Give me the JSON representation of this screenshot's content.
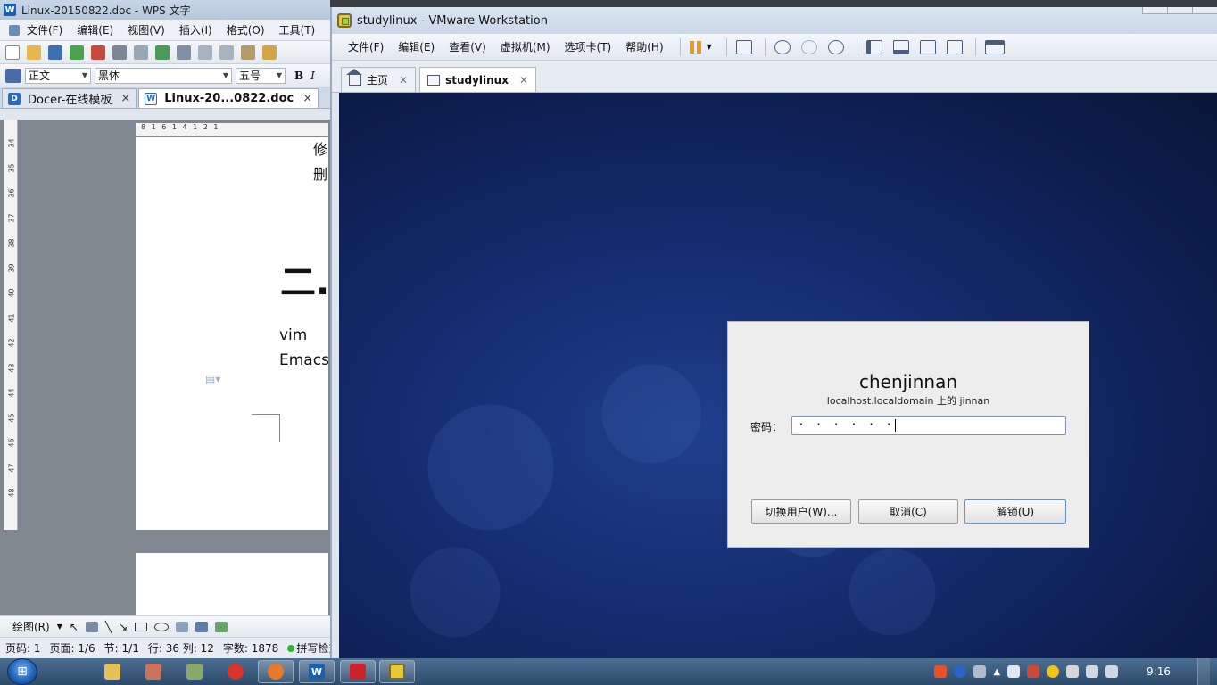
{
  "wps": {
    "title": "Linux-20150822.doc - WPS 文字",
    "menu": [
      "文件(F)",
      "编辑(E)",
      "视图(V)",
      "插入(I)",
      "格式(O)",
      "工具(T)"
    ],
    "style_value": "正文",
    "font_value": "黑体",
    "size_value": "五号",
    "tabs": [
      {
        "label": "Docer-在线模板",
        "active": false
      },
      {
        "label": "Linux-20...0822.doc",
        "active": true
      }
    ],
    "ruler_h": "8 1 6 1 4 1 2 1",
    "ruler_v": [
      "34",
      "35",
      "36",
      "37",
      "38",
      "39",
      "40",
      "41",
      "42",
      "43",
      "44",
      "45",
      "46",
      "47",
      "48"
    ],
    "page_text": {
      "line1": "修",
      "line2": "删",
      "heading": "二.",
      "vim": "vim",
      "emacs": "Emacs"
    },
    "drawbar_label": "绘图(R)",
    "status": {
      "page": "页码: 1",
      "pages": "页面: 1/6",
      "section": "节: 1/1",
      "rowcol": "行: 36  列: 12",
      "words": "字数: 1878",
      "spell": "拼写检查"
    }
  },
  "vmware": {
    "title": "studylinux - VMware Workstation",
    "menu": [
      "文件(F)",
      "编辑(E)",
      "查看(V)",
      "虚拟机(M)",
      "选项卡(T)",
      "帮助(H)"
    ],
    "tabs": [
      {
        "label": "主页",
        "active": false
      },
      {
        "label": "studylinux",
        "active": true
      }
    ],
    "dialog": {
      "username": "chenjinnan",
      "host": "localhost.localdomain 上的  jinnan",
      "password_label": "密码：",
      "password_mask": "· · · · · ·",
      "switch_user": "切换用户(W)...",
      "cancel": "取消(C)",
      "unlock": "解锁(U)"
    }
  },
  "taskbar": {
    "clock": "9:16"
  },
  "colors": {
    "vm_bg_dark": "#0d1d4e",
    "vm_bg_mid": "#1f3e8c",
    "dialog_bg": "#ededed",
    "pause_orange": "#e59a1b"
  }
}
